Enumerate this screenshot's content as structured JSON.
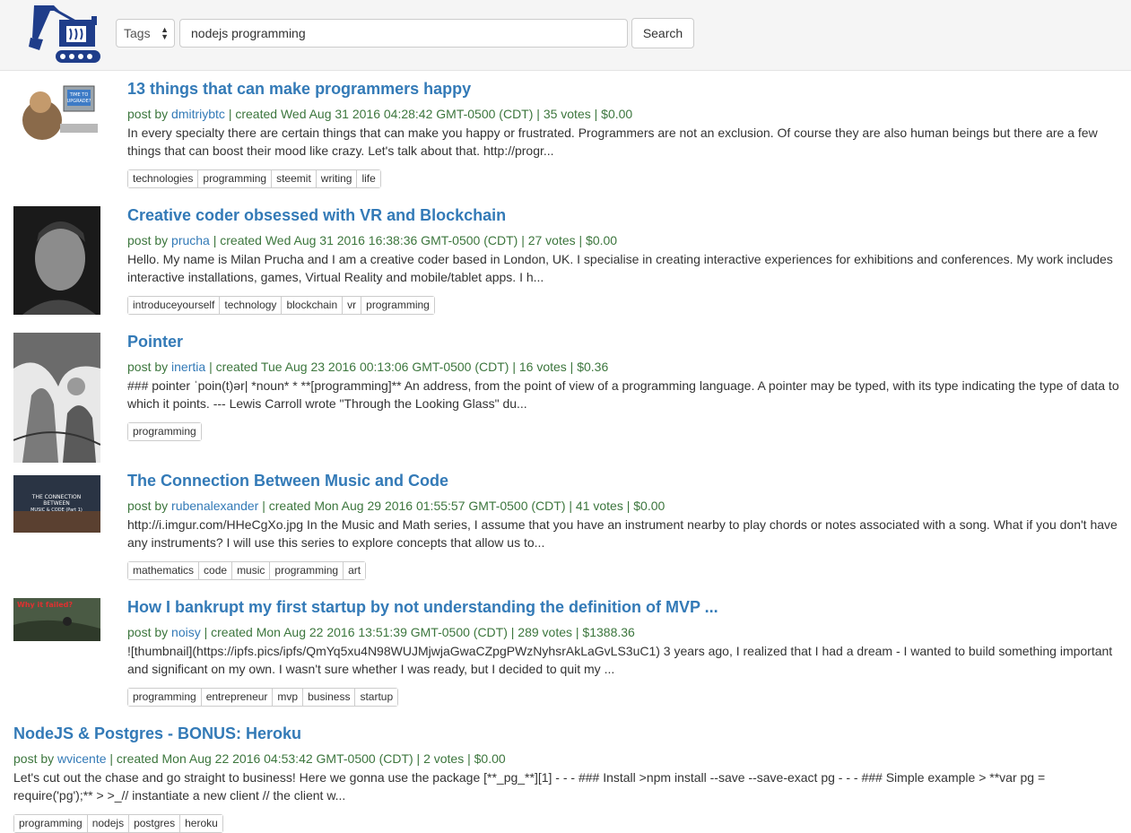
{
  "header": {
    "tags_select": "Tags",
    "search_value": "nodejs programming",
    "search_button": "Search"
  },
  "posts": [
    {
      "title": "13 things that can make programmers happy",
      "by_label": "post by",
      "author": "dmitriybtc",
      "created": "| created Wed Aug 31 2016 04:28:42 GMT-0500 (CDT) | 35 votes | $0.00",
      "excerpt": "In every specialty there are certain things that can make you happy or frustrated. Programmers are not an exclusion. Of course they are also human beings but there are a few things that can boost their mood like crazy. Let's talk about that. http://progr...",
      "tags": [
        "technologies",
        "programming",
        "steemit",
        "writing",
        "life"
      ],
      "thumb_text": "TIME TO UPGRADE?"
    },
    {
      "title": "Creative coder obsessed with VR and Blockchain",
      "by_label": "post by",
      "author": "prucha",
      "created": "| created Wed Aug 31 2016 16:38:36 GMT-0500 (CDT) | 27 votes | $0.00",
      "excerpt": "Hello. My name is Milan Prucha and I am a creative coder based in London, UK. I specialise in creating interactive experiences for exhibitions and conferences. My work includes interactive installations, games, Virtual Reality and mobile/tablet apps. I h...",
      "tags": [
        "introduceyourself",
        "technology",
        "blockchain",
        "vr",
        "programming"
      ]
    },
    {
      "title": "Pointer",
      "by_label": "post by",
      "author": "inertia",
      "created": "| created Tue Aug 23 2016 00:13:06 GMT-0500 (CDT) | 16 votes | $0.36",
      "excerpt": "### pointer ˈpoin(t)ər| *noun* * **[programming]** An address, from the point of view of a programming language. A pointer may be typed, with its type indicating the type of data to which it points. --- Lewis Carroll wrote \"Through the Looking Glass\" du...",
      "tags": [
        "programming"
      ]
    },
    {
      "title": "The Connection Between Music and Code",
      "by_label": "post by",
      "author": "rubenalexander",
      "created": "| created Mon Aug 29 2016 01:55:57 GMT-0500 (CDT) | 41 votes | $0.00",
      "excerpt": "http://i.imgur.com/HHeCgXo.jpg In the Music and Math series, I assume that you have an instrument nearby to play chords or notes associated with a song. What if you don't have any instruments? I will use this series to explore concepts that allow us to...",
      "tags": [
        "mathematics",
        "code",
        "music",
        "programming",
        "art"
      ],
      "thumb_text": "THE CONNECTION BETWEEN MUSIC & CODE (Part 1)"
    },
    {
      "title": "How I bankrupt my first startup by not understanding the definition of MVP ...",
      "by_label": "post by",
      "author": "noisy",
      "created": "| created Mon Aug 22 2016 13:51:39 GMT-0500 (CDT) | 289 votes | $1388.36",
      "excerpt": "![thumbnail](https://ipfs.pics/ipfs/QmYq5xu4N98WUJMjwjaGwaCZpgPWzNyhsrAkLaGvLS3uC1) 3 years ago, I realized that I had a dream - I wanted to build something important and significant on my own. I wasn't sure whether I was ready, but I decided to quit my ...",
      "tags": [
        "programming",
        "entrepreneur",
        "mvp",
        "business",
        "startup"
      ],
      "thumb_text": "Why it failed?"
    },
    {
      "title": "NodeJS & Postgres - BONUS: Heroku",
      "by_label": "post by",
      "author": "wvicente",
      "created": "| created Mon Aug 22 2016 04:53:42 GMT-0500 (CDT) | 2 votes | $0.00",
      "excerpt": "Let's cut out the chase and go straight to business! Here we gonna use the package [**_pg_**][1] - - - ### Install >npm install --save --save-exact pg - - - ### Simple example > **var pg = require('pg');** > >_// instantiate a new client // the client w...",
      "tags": [
        "programming",
        "nodejs",
        "postgres",
        "heroku"
      ]
    }
  ]
}
